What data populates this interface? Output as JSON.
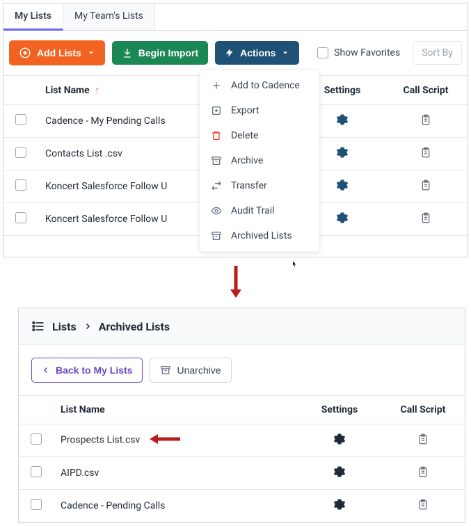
{
  "tabs": {
    "my_lists": "My Lists",
    "team_lists": "My Team's Lists"
  },
  "toolbar": {
    "add_lists": "Add Lists",
    "begin_import": "Begin Import",
    "actions": "Actions",
    "show_favorites": "Show Favorites",
    "sort_by": "Sort By"
  },
  "columns": {
    "list_name": "List Name",
    "settings": "Settings",
    "call_script": "Call Script"
  },
  "rows_top": [
    {
      "name": "Cadence - My Pending Calls"
    },
    {
      "name": "Contacts List .csv"
    },
    {
      "name": "Koncert Salesforce Follow U"
    },
    {
      "name": "Koncert Salesforce Follow U"
    }
  ],
  "actions_menu": {
    "add_to_cadence": "Add to Cadence",
    "export": "Export",
    "delete": "Delete",
    "archive": "Archive",
    "transfer": "Transfer",
    "audit_trail": "Audit Trail",
    "archived_lists": "Archived Lists"
  },
  "breadcrumb": {
    "lists": "Lists",
    "archived_lists": "Archived Lists"
  },
  "toolbar2": {
    "back": "Back to My Lists",
    "unarchive": "Unarchive"
  },
  "rows_bottom": [
    {
      "name": "Prospects List.csv"
    },
    {
      "name": "AIPD.csv"
    },
    {
      "name": "Cadence - Pending Calls"
    }
  ]
}
